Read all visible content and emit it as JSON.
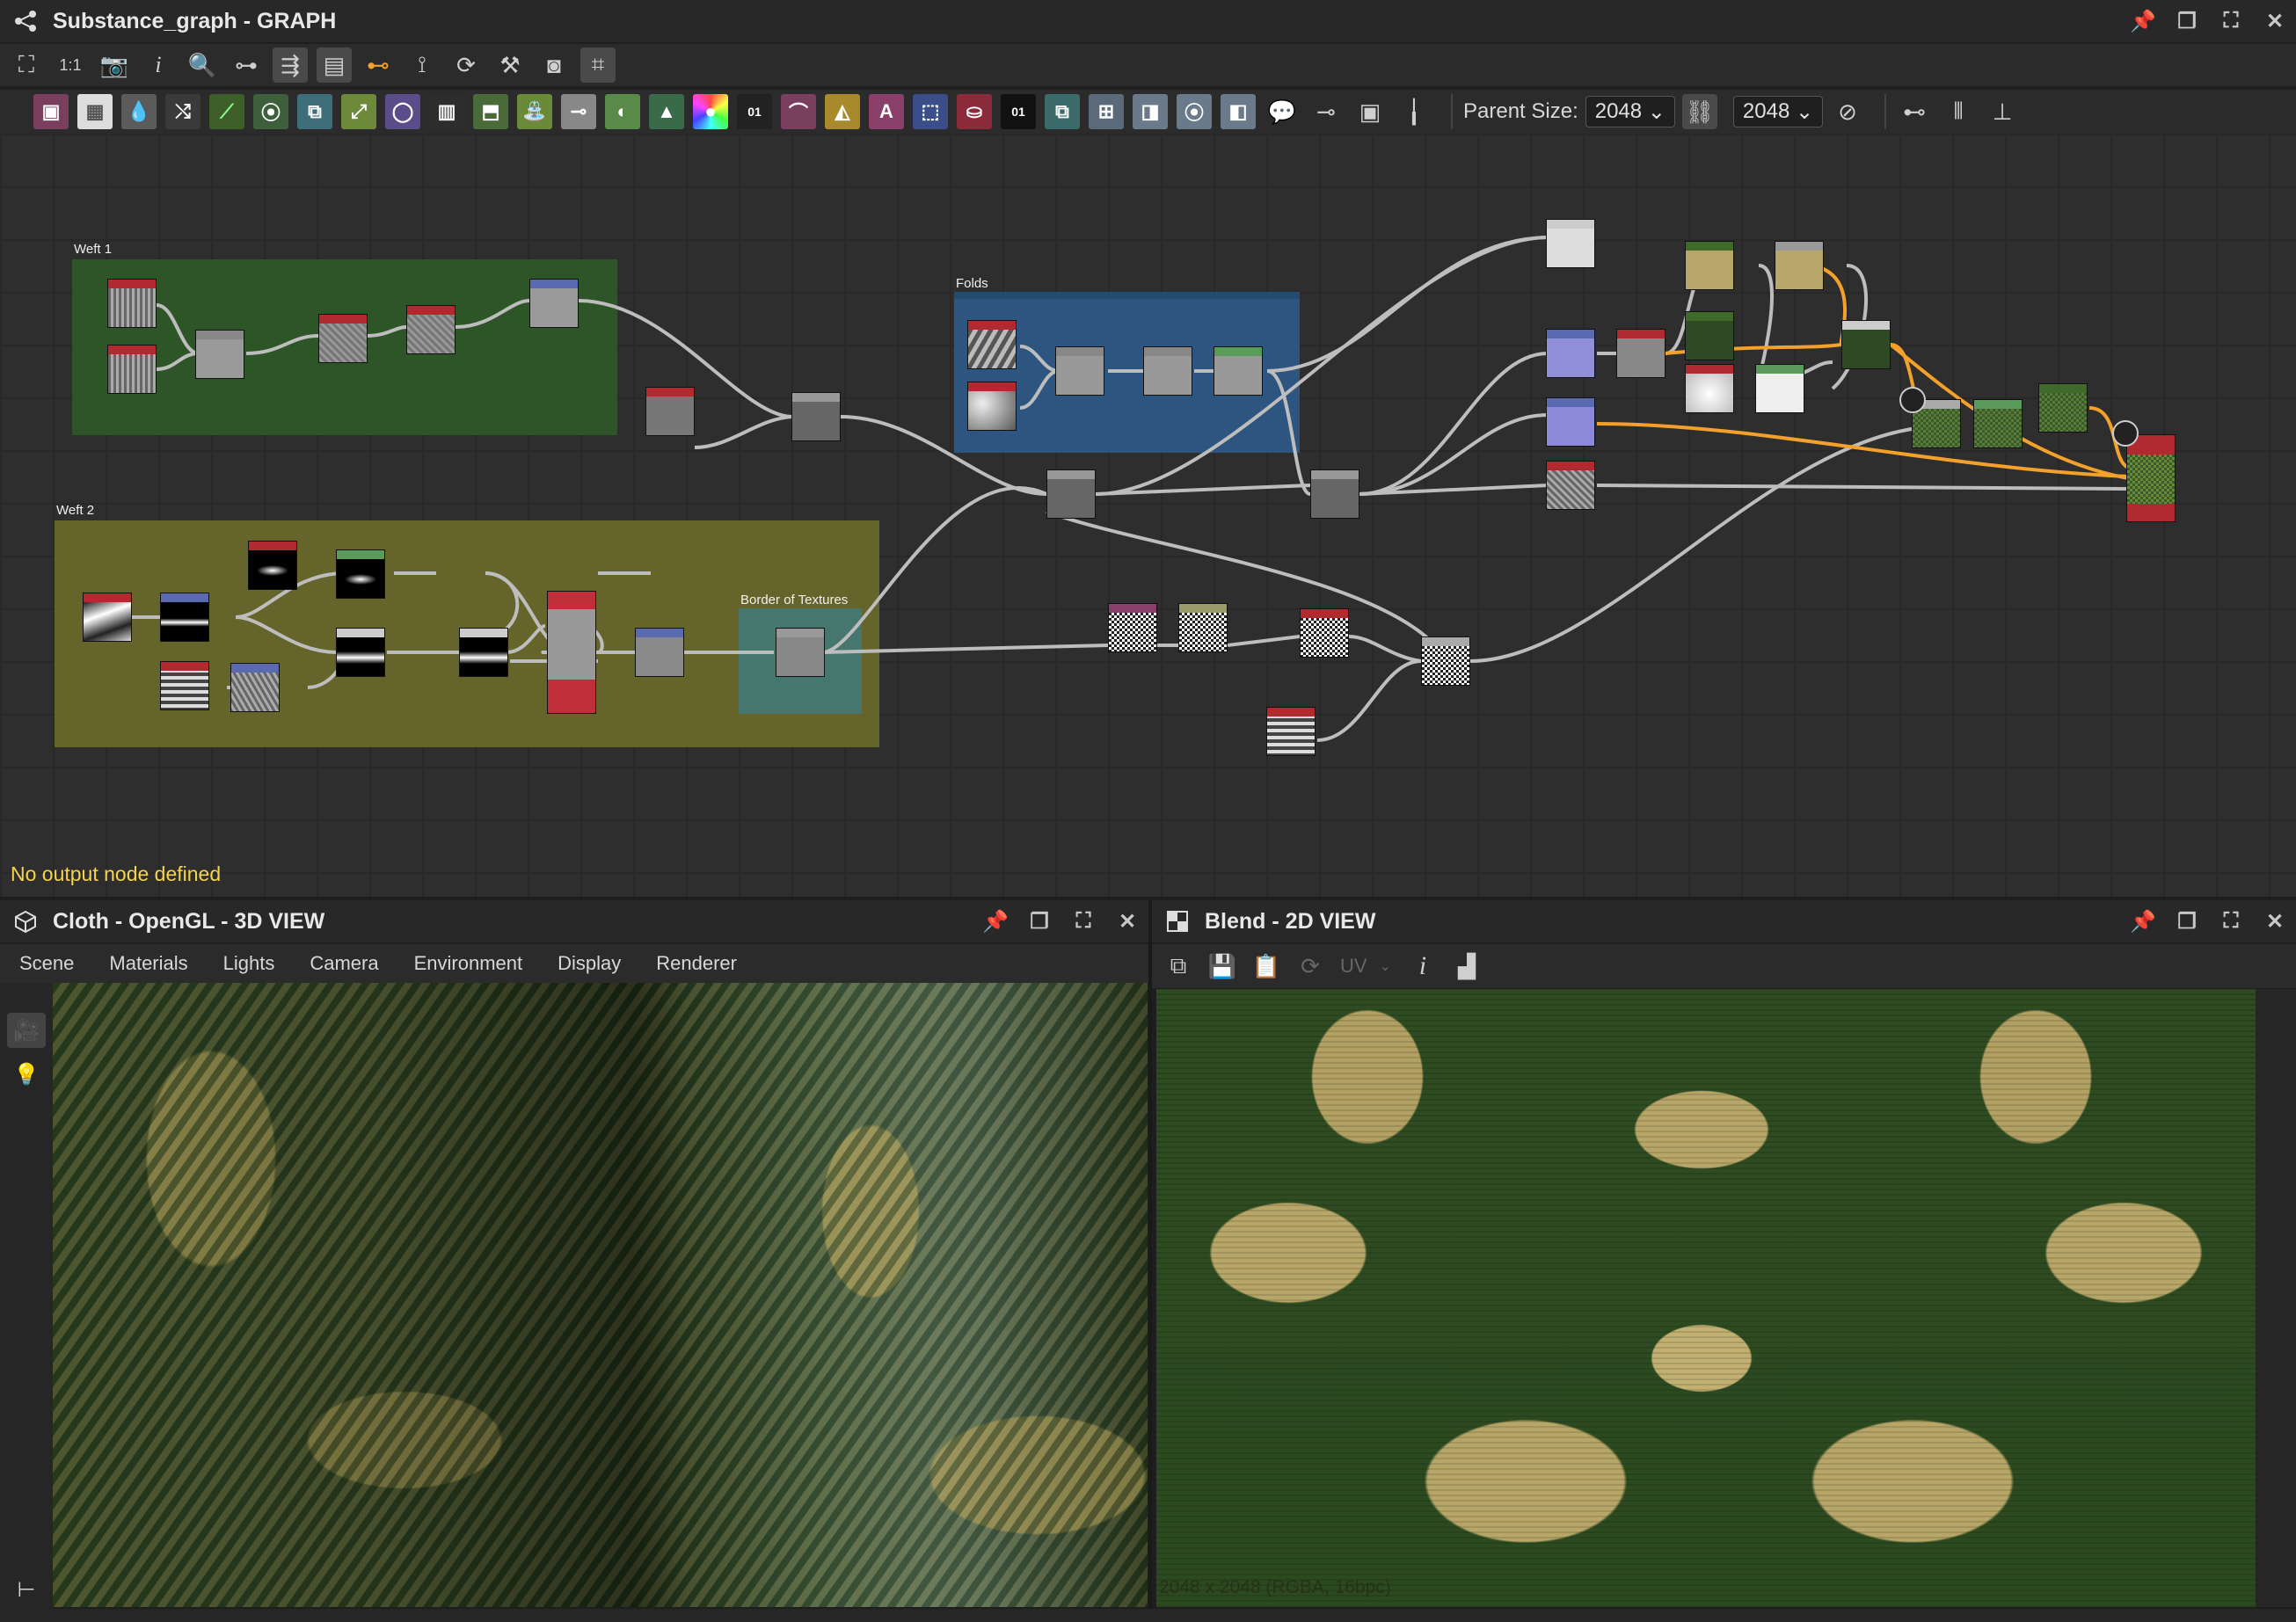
{
  "graph_panel": {
    "title": "Substance_graph - GRAPH",
    "status_text": "No output node defined",
    "parent_size_label": "Parent Size:",
    "size_width": "2048",
    "size_height": "2048",
    "frames": {
      "weft1": "Weft 1",
      "weft2": "Weft 2",
      "folds": "Folds",
      "border": "Border of Textures"
    },
    "atomic_labels": {
      "text_node": "A",
      "fx_node": "01",
      "fx_node2": "01"
    }
  },
  "view3d": {
    "title": "Cloth - OpenGL - 3D VIEW",
    "menu": [
      "Scene",
      "Materials",
      "Lights",
      "Camera",
      "Environment",
      "Display",
      "Renderer"
    ]
  },
  "view2d": {
    "title": "Blend - 2D VIEW",
    "uv_label": "UV",
    "info_label": "i",
    "resolution_text": "2048 x 2048 (RGBA, 16bpc)"
  },
  "colors": {
    "weft1_frame": "#2f5b27",
    "weft2_frame": "#6b6a2a",
    "folds_frame": "#2f5a8a",
    "border_frame": "#3f7a7a",
    "status_yellow": "#f6d34e",
    "wire_orange": "#f4a12c"
  },
  "icons": {
    "graph": "share-graph-icon",
    "cube": "cube-icon",
    "grid2d": "grid-2d-icon",
    "pin": "pin-icon",
    "restore": "restore-icon",
    "maximize": "maximize-icon",
    "close": "close-icon"
  }
}
